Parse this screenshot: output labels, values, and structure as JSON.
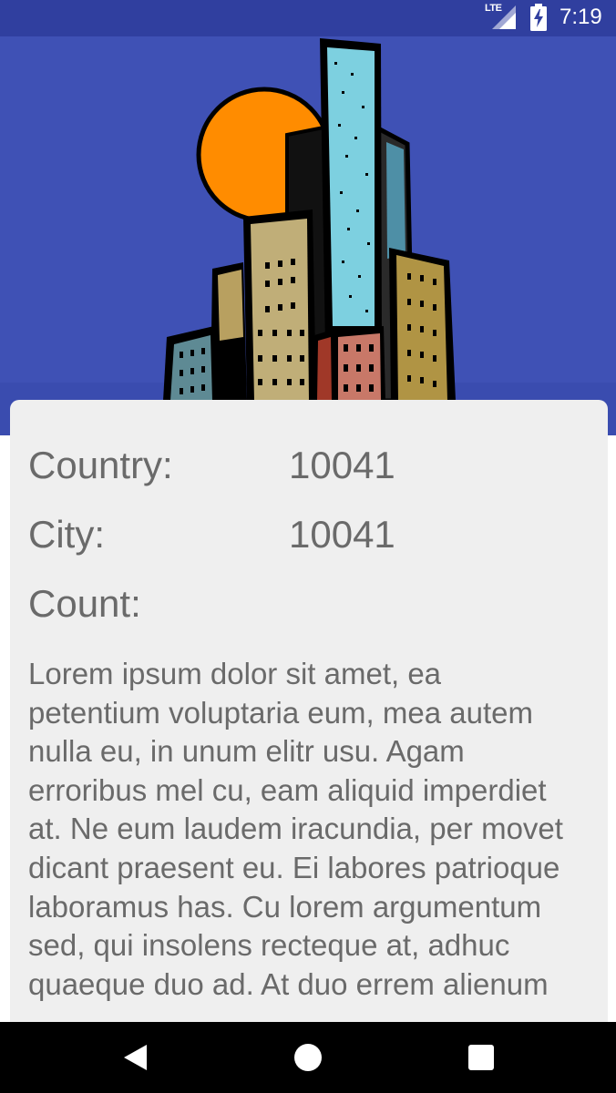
{
  "status_bar": {
    "network": "LTE",
    "time": "7:19",
    "icons": [
      "signal-icon",
      "battery-charging-icon"
    ]
  },
  "header": {
    "image": "city-skyline-illustration",
    "colors": {
      "background": "#3F51B5",
      "status_bar": "#303F9F"
    }
  },
  "details": {
    "country_label": "Country:",
    "country_value": "10041",
    "city_label": "City:",
    "city_value": "10041",
    "count_label": "Count:",
    "count_value": ""
  },
  "description": "Lorem ipsum dolor sit amet, ea petentium voluptaria eum, mea autem nulla eu, in unum elitr usu. Agam erroribus mel cu, eam aliquid imperdiet at. Ne eum laudem iracundia, per movet dicant praesent eu. Ei labores patrioque laboramus has. Cu lorem argumentum sed, qui insolens recteque at, adhuc quaeque duo ad. At duo errem alienum",
  "nav_bar": {
    "icons": [
      "back-icon",
      "home-icon",
      "recents-icon"
    ]
  }
}
